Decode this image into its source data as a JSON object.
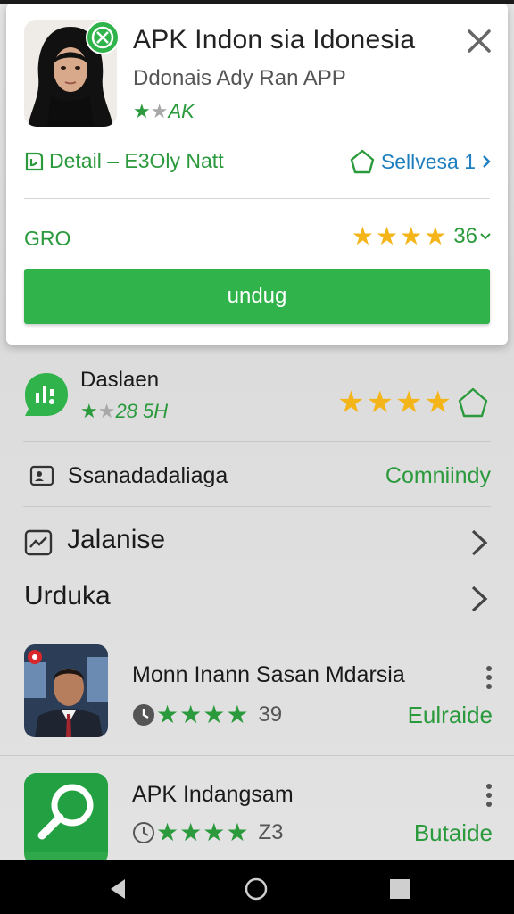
{
  "card": {
    "title": "APK Indon sia Idonesia",
    "subtitle": "Ddonais Ady Ran APP",
    "badge_primary": "★",
    "badge_dim": "★",
    "badge_text": "AK",
    "detail_link": "Detail – E3Oly Natt",
    "service_link": "Sellvesa 1",
    "grade": "GRO",
    "rating_count": "36",
    "install_label": "undug"
  },
  "app_row": {
    "name": "Daslaen",
    "meta_primary": "★",
    "meta_dim": "★",
    "meta_text": "28 5H",
    "stars": [
      "★",
      "★",
      "★",
      "★"
    ]
  },
  "user_row": {
    "label": "Ssanadadaliaga",
    "right_label": "Comniindy"
  },
  "nav_rows": [
    {
      "label": "Jalanise"
    },
    {
      "label": "Urduka"
    }
  ],
  "apps": [
    {
      "name": "Monn Inann Sasan Mdarsia",
      "stars": [
        "★",
        "★",
        "★",
        "★"
      ],
      "count": "39",
      "action": "Eulraide"
    },
    {
      "name": "APK Indangsam",
      "stars": [
        "★",
        "★",
        "★",
        "★"
      ],
      "count": "Z3",
      "action": "Butaide"
    }
  ],
  "colors": {
    "accent_green": "#2fb34a",
    "text_green": "#2a9a3c",
    "link_blue": "#1e7fbf",
    "star_gold": "#f4b51a"
  },
  "icons": {
    "close": "close-icon",
    "verify": "check-circle-icon",
    "detail": "document-icon",
    "service": "star-outline-icon",
    "app1": "chat-bubble-icon",
    "user": "id-card-icon",
    "trend": "chart-icon",
    "search": "search-icon",
    "back": "back-icon",
    "home": "home-icon",
    "recents": "recents-icon"
  }
}
